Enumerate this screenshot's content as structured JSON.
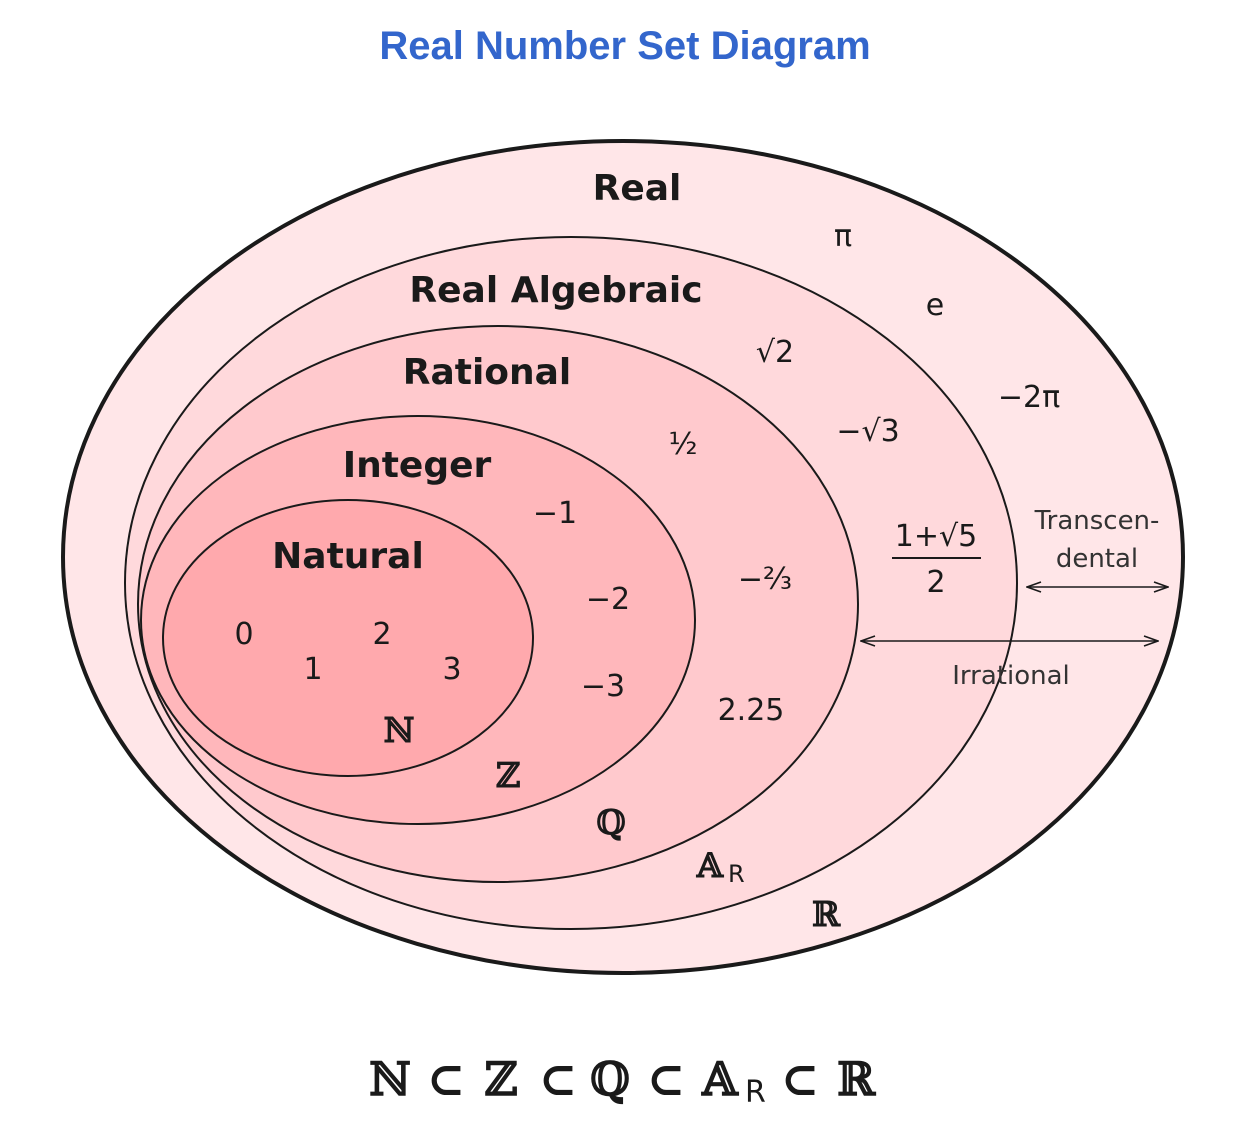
{
  "title": "Real Number Set Diagram",
  "colors": {
    "title": "#3366cc",
    "real_fill": "#ffe6e8",
    "algebraic_fill": "#ffd9dc",
    "rational_fill": "#ffc9cd",
    "integer_fill": "#ffb7bb",
    "natural_fill": "#ffa9ad",
    "outline": "#1a1a1a"
  },
  "sets": {
    "real": {
      "label": "Real",
      "symbol": "ℝ"
    },
    "real_algebraic": {
      "label": "Real Algebraic",
      "symbol": "𝔸",
      "symbol_subscript": "R"
    },
    "rational": {
      "label": "Rational",
      "symbol": "ℚ"
    },
    "integer": {
      "label": "Integer",
      "symbol": "ℤ"
    },
    "natural": {
      "label": "Natural",
      "symbol": "ℕ"
    }
  },
  "examples": {
    "natural": [
      "0",
      "1",
      "2",
      "3"
    ],
    "integer": [
      "−1",
      "−2",
      "−3"
    ],
    "rational": [
      "½",
      "−⅔",
      "2.25"
    ],
    "algebraic": [
      "√2",
      "−√3",
      "1+√5",
      "2"
    ],
    "real": [
      "π",
      "e",
      "−2π"
    ]
  },
  "annotations": {
    "transcendental_line1": "Transcen-",
    "transcendental_line2": "dental",
    "irrational": "Irrational"
  },
  "chain": {
    "n": "ℕ",
    "subset": "⊂",
    "z": "ℤ",
    "q": "ℚ",
    "a": "𝔸",
    "a_sub": "R",
    "r": "ℝ"
  }
}
